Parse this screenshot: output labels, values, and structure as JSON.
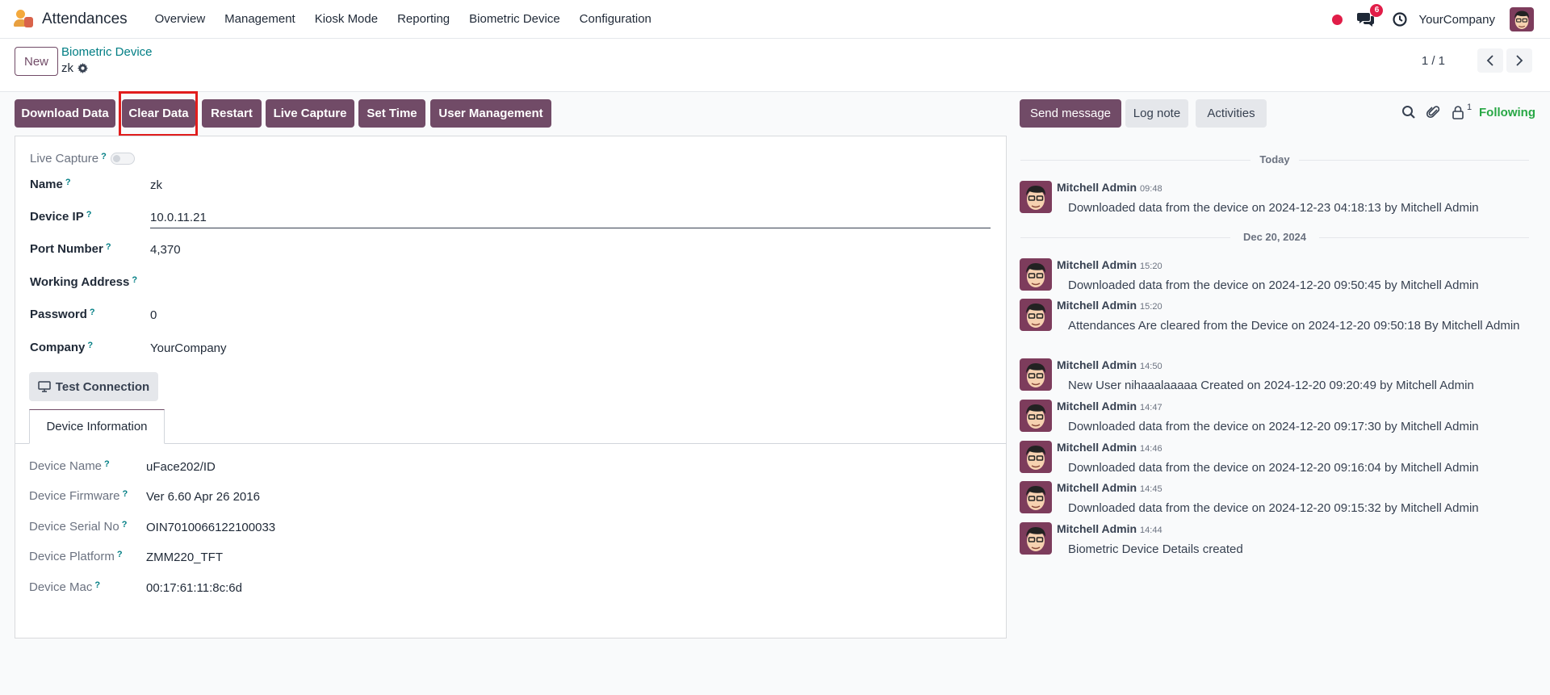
{
  "navbar": {
    "app_name": "Attendances",
    "menu": [
      "Overview",
      "Management",
      "Kiosk Mode",
      "Reporting",
      "Biometric Device",
      "Configuration"
    ],
    "messages_count": "6",
    "company": "YourCompany"
  },
  "control_panel": {
    "new_label": "New",
    "breadcrumb": "Biometric Device",
    "record_name": "zk",
    "pager": "1 / 1"
  },
  "actions": {
    "download_data": "Download Data",
    "clear_data": "Clear Data",
    "restart": "Restart",
    "live_capture": "Live Capture",
    "set_time": "Set Time",
    "user_management": "User Management"
  },
  "form": {
    "live_capture_label": "Live Capture",
    "name_label": "Name",
    "name_value": "zk",
    "device_ip_label": "Device IP",
    "device_ip_value": "10.0.11.21",
    "port_label": "Port Number",
    "port_value": "4,370",
    "working_address_label": "Working Address",
    "password_label": "Password",
    "password_value": "0",
    "company_label": "Company",
    "company_value": "YourCompany",
    "test_connection": "Test Connection",
    "tab_device_info": "Device Information",
    "help_mark": "?",
    "device_info": [
      {
        "label": "Device Name",
        "value": "uFace202/ID"
      },
      {
        "label": "Device Firmware",
        "value": "Ver 6.60 Apr 26 2016"
      },
      {
        "label": "Device Serial No",
        "value": "OIN7010066122100033"
      },
      {
        "label": "Device Platform",
        "value": "ZMM220_TFT"
      },
      {
        "label": "Device Mac",
        "value": "00:17:61:11:8c:6d"
      }
    ]
  },
  "chatter": {
    "send_message": "Send message",
    "log_note": "Log note",
    "activities": "Activities",
    "followers_count": "1",
    "following": "Following",
    "sep_today": "Today",
    "sep_dec20": "Dec 20, 2024",
    "messages": [
      {
        "author": "Mitchell Admin",
        "time": "09:48",
        "body": "Downloaded data from the device on 2024-12-23 04:18:13 by Mitchell Admin"
      },
      {
        "author": "Mitchell Admin",
        "time": "15:20",
        "body": "Downloaded data from the device on 2024-12-20 09:50:45 by Mitchell Admin"
      },
      {
        "author": "Mitchell Admin",
        "time": "15:20",
        "body": "Attendances Are cleared from the Device on 2024-12-20 09:50:18 By Mitchell Admin"
      },
      {
        "author": "Mitchell Admin",
        "time": "14:50",
        "body": "New User nihaaalaaaaa Created on 2024-12-20 09:20:49 by Mitchell Admin"
      },
      {
        "author": "Mitchell Admin",
        "time": "14:47",
        "body": "Downloaded data from the device on 2024-12-20 09:17:30 by Mitchell Admin"
      },
      {
        "author": "Mitchell Admin",
        "time": "14:46",
        "body": "Downloaded data from the device on 2024-12-20 09:16:04 by Mitchell Admin"
      },
      {
        "author": "Mitchell Admin",
        "time": "14:45",
        "body": "Downloaded data from the device on 2024-12-20 09:15:32 by Mitchell Admin"
      },
      {
        "author": "Mitchell Admin",
        "time": "14:44",
        "body": "Biometric Device Details created"
      }
    ]
  },
  "colors": {
    "primary": "#714b67",
    "link": "#017e84",
    "following": "#28a745",
    "highlight": "#e11d1d"
  }
}
